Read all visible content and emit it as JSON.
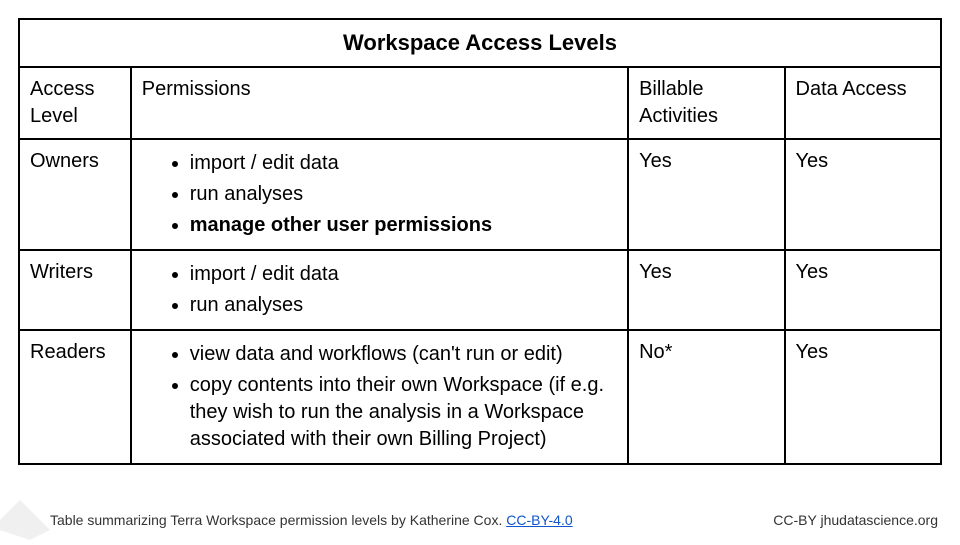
{
  "title": "Workspace Access Levels",
  "headers": {
    "level": "Access Level",
    "permissions": "Permissions",
    "billable": "Billable Activities",
    "data_access": "Data Access"
  },
  "rows": [
    {
      "level": "Owners",
      "permissions": [
        {
          "text": "import / edit data",
          "bold": false
        },
        {
          "text": "run analyses",
          "bold": false
        },
        {
          "text": "manage other user permissions",
          "bold": true
        }
      ],
      "billable": "Yes",
      "data_access": "Yes"
    },
    {
      "level": "Writers",
      "permissions": [
        {
          "text": "import / edit data",
          "bold": false
        },
        {
          "text": "run analyses",
          "bold": false
        }
      ],
      "billable": "Yes",
      "data_access": "Yes"
    },
    {
      "level": "Readers",
      "permissions": [
        {
          "text": "view data and workflows (can't run or edit)",
          "bold": false
        },
        {
          "text": "copy contents into their own Workspace (if e.g. they wish to run the analysis in a Workspace associated with their own Billing Project)",
          "bold": false
        }
      ],
      "billable": "No*",
      "data_access": "Yes"
    }
  ],
  "footer": {
    "caption_prefix": "Table summarizing Terra Workspace permission levels by Katherine Cox.  ",
    "license_link": "CC-BY-4.0",
    "attribution": "CC-BY  jhudatascience.org"
  }
}
